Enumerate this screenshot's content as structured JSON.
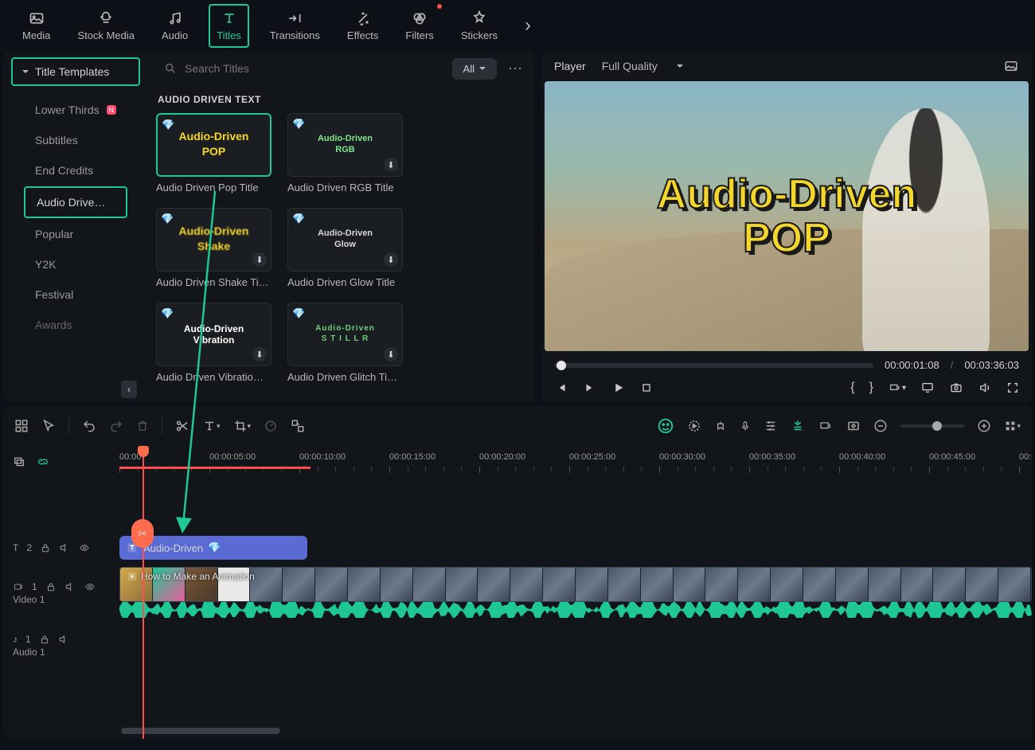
{
  "nav": {
    "items": [
      {
        "label": "Media"
      },
      {
        "label": "Stock Media"
      },
      {
        "label": "Audio"
      },
      {
        "label": "Titles"
      },
      {
        "label": "Transitions"
      },
      {
        "label": "Effects"
      },
      {
        "label": "Filters"
      },
      {
        "label": "Stickers"
      }
    ]
  },
  "sidebar": {
    "dropdown": "Title Templates",
    "items": [
      {
        "label": "Lower Thirds",
        "badge": "N"
      },
      {
        "label": "Subtitles"
      },
      {
        "label": "End Credits"
      },
      {
        "label": "Audio Drive…"
      },
      {
        "label": "Popular"
      },
      {
        "label": "Y2K"
      },
      {
        "label": "Festival"
      },
      {
        "label": "Awards"
      }
    ]
  },
  "search": {
    "placeholder": "Search Titles",
    "filter": "All"
  },
  "section": {
    "title": "AUDIO DRIVEN TEXT"
  },
  "cards": [
    {
      "label": "Audio Driven Pop Title",
      "thumbLine1": "Audio-Driven",
      "thumbLine2": "POP",
      "color": "#f5d72b",
      "shadow": true,
      "font": "Impact"
    },
    {
      "label": "Audio Driven RGB Title",
      "thumbLine1": "Audio-Driven",
      "thumbLine2": "RGB",
      "color": "#7fe88a",
      "shadow": false,
      "font": "Courier"
    },
    {
      "label": "Audio Driven Shake Ti…",
      "thumbLine1": "Audio-Driven",
      "thumbLine2": "Shake",
      "color": "#f5d72b",
      "shadow": true,
      "font": "Impact",
      "blur": true
    },
    {
      "label": "Audio Driven Glow Title",
      "thumbLine1": "Audio-Driven",
      "thumbLine2": "Glow",
      "color": "#d8d8d8",
      "shadow": false,
      "font": "Courier"
    },
    {
      "label": "Audio Driven Vibratio…",
      "thumbLine1": "Audio-Driven",
      "thumbLine2": "Vibration",
      "color": "#ffffff",
      "shadow": true,
      "font": "Arial"
    },
    {
      "label": "Audio Driven Glitch Ti…",
      "thumbLine1": "Audio-Driven",
      "thumbLine2": "S T I L L R",
      "color": "#6fcf7a",
      "shadow": false,
      "font": "Courier"
    }
  ],
  "player": {
    "title": "Player",
    "quality": "Full Quality",
    "overlayLine1": "Audio-Driven",
    "overlayLine2": "POP",
    "current": "00:00:01:08",
    "total": "00:03:36:03"
  },
  "timeline": {
    "ticks": [
      "00:00",
      "00:00:05:00",
      "00:00:10:00",
      "00:00:15:00",
      "00:00:20:00",
      "00:00:25:00",
      "00:00:30:00",
      "00:00:35:00",
      "00:00:40:00",
      "00:00:45:00",
      "00:0"
    ],
    "titleClip": "Audio-Driven",
    "videoClip": "How to Make an Animation",
    "tracks": {
      "t1": "2",
      "t2": "1",
      "t2name": "Video 1",
      "t3": "1",
      "t3name": "Audio 1"
    }
  }
}
